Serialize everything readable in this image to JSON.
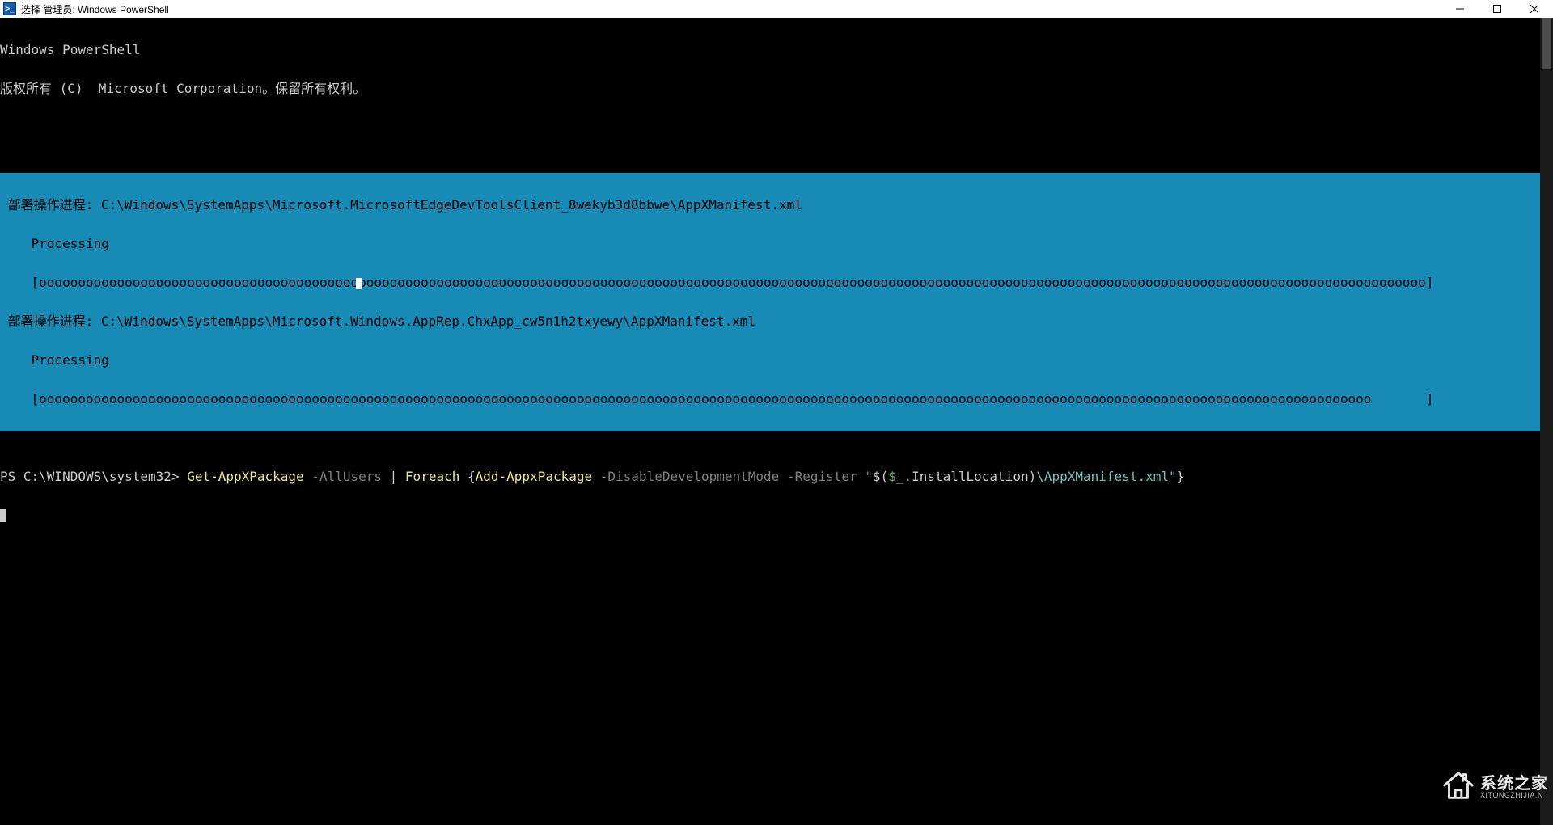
{
  "titlebar": {
    "icon_label": ">_",
    "title": "选择 管理员: Windows PowerShell"
  },
  "header": {
    "line1": "Windows PowerShell",
    "line2": "版权所有 (C)  Microsoft Corporation。保留所有权利。"
  },
  "progress": [
    {
      "title": " 部署操作进程: C:\\Windows\\SystemApps\\Microsoft.MicrosoftEdgeDevToolsClient_8wekyb3d8bbwe\\AppXManifest.xml",
      "status": "    Processing",
      "bar": "    [oooooooooooooooooooooooooooooooooooooooooooooooooooooooooooooooooooooooooooooooooooooooooooooooooooooooooooooooooooooooooooooooooooooooooooooooooooooooooooooooooooooooooooooooooo]"
    },
    {
      "title": " 部署操作进程: C:\\Windows\\SystemApps\\Microsoft.Windows.AppRep.ChxApp_cw5n1h2txyewy\\AppXManifest.xml",
      "status": "    Processing",
      "bar": "    [ooooooooooooooooooooooooooooooooooooooooooooooooooooooooooooooooooooooooooooooooooooooooooooooooooooooooooooooooooooooooooooooooooooooooooooooooooooooooooooooooooooooooooo       ]"
    }
  ],
  "cmd": {
    "prompt": "PS C:\\WINDOWS\\system32> ",
    "seg1": "Get-AppXPackage",
    "seg2": " -AllUsers ",
    "pipe": "| ",
    "seg3": "Foreach",
    "brace_open": " {",
    "seg4": "Add-AppxPackage",
    "seg5": " -DisableDevelopmentMode -Register ",
    "q1": "\"",
    "seg6": "$(",
    "seg7": "$_",
    "seg8": ".InstallLocation",
    "seg9": ")",
    "seg10": "\\AppXManifest.xml\"",
    "brace_close": "}"
  },
  "watermark": {
    "cn": "系统之家",
    "en": "XITONGZHIJIA.N"
  },
  "scrollbar": {
    "thumb_top": 0,
    "thumb_height": 64
  }
}
